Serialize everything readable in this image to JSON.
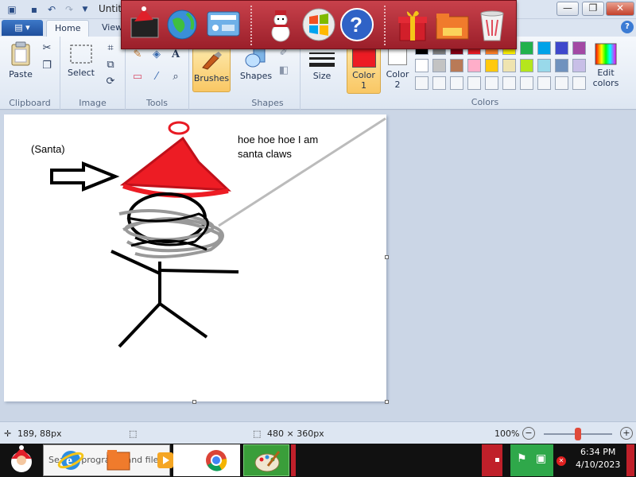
{
  "window": {
    "title": "Untit",
    "minimize": "—",
    "maximize": "❐",
    "close": "✕"
  },
  "tabs": {
    "file": "▤ ▾",
    "home": "Home",
    "view": "View",
    "help": "?"
  },
  "ribbon": {
    "clipboard": {
      "paste": "Paste",
      "group": "Clipboard"
    },
    "image": {
      "select": "Select",
      "group": "Image"
    },
    "tools": {
      "group": "Tools"
    },
    "brushes": {
      "label": "Brushes"
    },
    "shapes": {
      "label": "Shapes",
      "group": "Shapes"
    },
    "size": {
      "label": "Size"
    },
    "color1": {
      "label": "Color",
      "index": "1",
      "value": "#ed1c24"
    },
    "color2": {
      "label": "Color",
      "index": "2",
      "value": "#ffffff"
    },
    "edit_colors": {
      "line1": "Edit",
      "line2": "colors"
    },
    "colors_group": "Colors",
    "palette_row1": [
      "#000000",
      "#7f7f7f",
      "#880015",
      "#ed1c24",
      "#ff7f27",
      "#fff200",
      "#22b14c",
      "#00a2e8",
      "#3f48cc",
      "#a349a4"
    ],
    "palette_row2": [
      "#ffffff",
      "#c3c3c3",
      "#b97a57",
      "#ffaec9",
      "#ffc90e",
      "#efe4b0",
      "#b5e61d",
      "#99d9ea",
      "#7092be",
      "#c8bfe7"
    ]
  },
  "drawing": {
    "label_santa": "(Santa)",
    "speech_line1": "hoe hoe hoe I am",
    "speech_line2": "santa claws"
  },
  "status": {
    "cursor_pos": "189, 88px",
    "image_size": "480 × 360px",
    "zoom": "100%",
    "zoom_level": 0.5
  },
  "taskbar": {
    "search_text": "Search programs and files",
    "time": "6:34 PM",
    "date": "4/10/2023"
  },
  "dock": {
    "icons": [
      "santa-computer-icon",
      "globe-icon",
      "control-panel-icon",
      "snowman-icon",
      "windows-logo-icon",
      "help-icon",
      "gift-icon",
      "folder-icon",
      "recycle-bin-icon"
    ]
  }
}
